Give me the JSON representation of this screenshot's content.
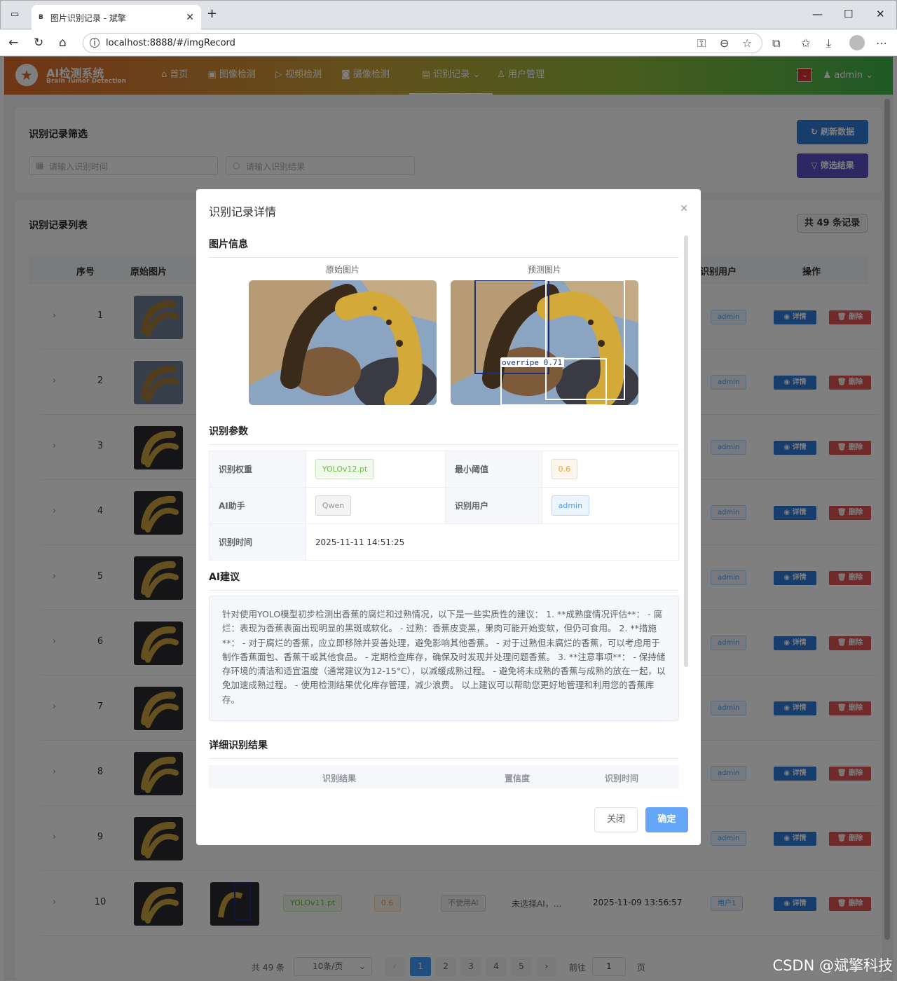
{
  "browser": {
    "tab_title": "图片识别记录 - 斌擎",
    "favicon_text": "B",
    "url": "localhost:8888/#/imgRecord"
  },
  "app": {
    "logo_title": "AI检测系统",
    "logo_subtitle": "Brain Tumor Detection",
    "menu": [
      "首页",
      "图像检测",
      "视频检测",
      "摄像检测",
      "识别记录",
      "用户管理"
    ],
    "active_menu": "识别记录",
    "user": "admin"
  },
  "filter": {
    "title": "识别记录筛选",
    "time_placeholder": "请输入识别时间",
    "result_placeholder": "请输入识别结果",
    "refresh_label": "刷新数据",
    "filter_label": "筛选结果"
  },
  "list": {
    "title": "识别记录列表",
    "total_badge": "共 49 条记录",
    "headers": [
      "序号",
      "原始图片",
      "识别用户",
      "操作"
    ],
    "detail_label": "详情",
    "delete_label": "删除",
    "rows": [
      {
        "num": "1",
        "user": "admin"
      },
      {
        "num": "2",
        "user": "admin"
      },
      {
        "num": "3",
        "user": "admin"
      },
      {
        "num": "4",
        "user": "admin"
      },
      {
        "num": "5",
        "user": "admin"
      },
      {
        "num": "6",
        "user": "admin"
      },
      {
        "num": "7",
        "user": "admin"
      },
      {
        "num": "8",
        "user": "admin"
      },
      {
        "num": "9",
        "user": "admin"
      },
      {
        "num": "10",
        "user": "用户1",
        "weight": "YOLOv11.pt",
        "threshold": "0.6",
        "ai": "不使用AI",
        "advice": "未选择AI，...",
        "time": "2025-11-09 13:56:57"
      }
    ]
  },
  "pagination": {
    "total": "共 49 条",
    "page_size": "10条/页",
    "pages": [
      "1",
      "2",
      "3",
      "4",
      "5"
    ],
    "goto_label": "前往",
    "goto_value": "1",
    "page_suffix": "页"
  },
  "modal": {
    "title": "识别记录详情",
    "sec_image": "图片信息",
    "orig_caption": "原始图片",
    "pred_caption": "预测图片",
    "detection_label": "overripe  0.71",
    "sec_params": "识别参数",
    "params": {
      "weight_label": "识别权重",
      "weight": "YOLOv12.pt",
      "threshold_label": "最小阈值",
      "threshold": "0.6",
      "ai_label": "AI助手",
      "ai": "Qwen",
      "user_label": "识别用户",
      "user": "admin",
      "time_label": "识别时间",
      "time": "2025-11-11 14:51:25"
    },
    "sec_ai": "AI建议",
    "advice": "针对使用YOLO模型初步检测出香蕉的腐烂和过熟情况，以下是一些实质性的建议： 1. **成熟度情况评估**： - 腐烂：表现为香蕉表面出现明显的黑斑或软化。 - 过熟：香蕉皮变黑，果肉可能开始变软，但仍可食用。 2. **措施**： - 对于腐烂的香蕉，应立即移除并妥善处理，避免影响其他香蕉。 - 对于过熟但未腐烂的香蕉，可以考虑用于制作香蕉面包、香蕉干或其他食品。 - 定期检查库存，确保及时发现并处理问题香蕉。 3. **注意事项**： - 保持储存环境的清洁和适宜温度（通常建议为12-15°C），以减缓成熟过程。 - 避免将未成熟的香蕉与成熟的放在一起，以免加速成熟过程。 - 使用检测结果优化库存管理，减少浪费。 以上建议可以帮助您更好地管理和利用您的香蕉库存。",
    "sec_detail": "详细识别结果",
    "detail_headers": [
      "识别结果",
      "置信度",
      "识别时间"
    ],
    "close_label": "关闭",
    "confirm_label": "确定"
  },
  "watermark": "CSDN @斌擎科技"
}
